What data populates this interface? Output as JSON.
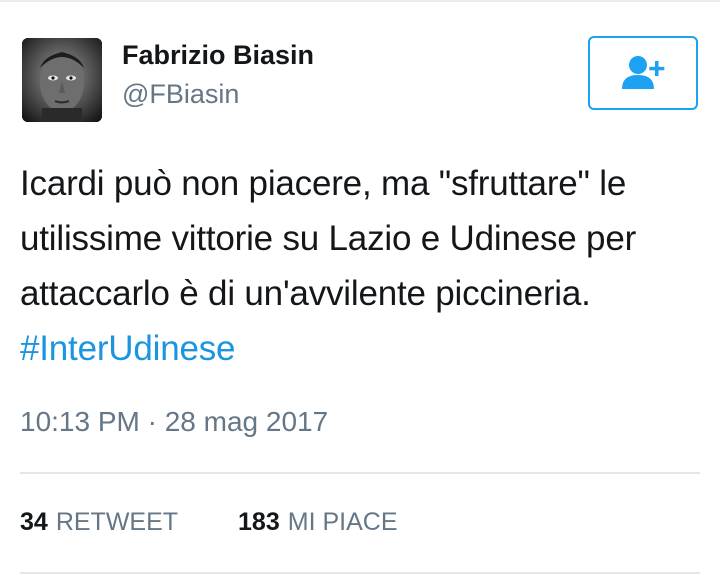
{
  "author": {
    "name": "Fabrizio Biasin",
    "handle": "@FBiasin"
  },
  "tweet": {
    "text_lines": [
      "Icardi può non piacere, ma \"sfruttare\" le",
      "utilissime vittorie su Lazio e Udinese per",
      "attaccarlo è di un'avvilente piccineria."
    ],
    "hashtag": "#InterUdinese",
    "timestamp": "10:13 PM · 28 mag 2017"
  },
  "stats": {
    "retweets_count": "34",
    "retweets_label": "RETWEET",
    "likes_count": "183",
    "likes_label": "MI PIACE"
  },
  "colors": {
    "accent": "#1da1f2",
    "hashtag": "#1b95e0",
    "secondary_text": "#657786"
  },
  "icons": {
    "follow_button": "add-user-icon"
  }
}
